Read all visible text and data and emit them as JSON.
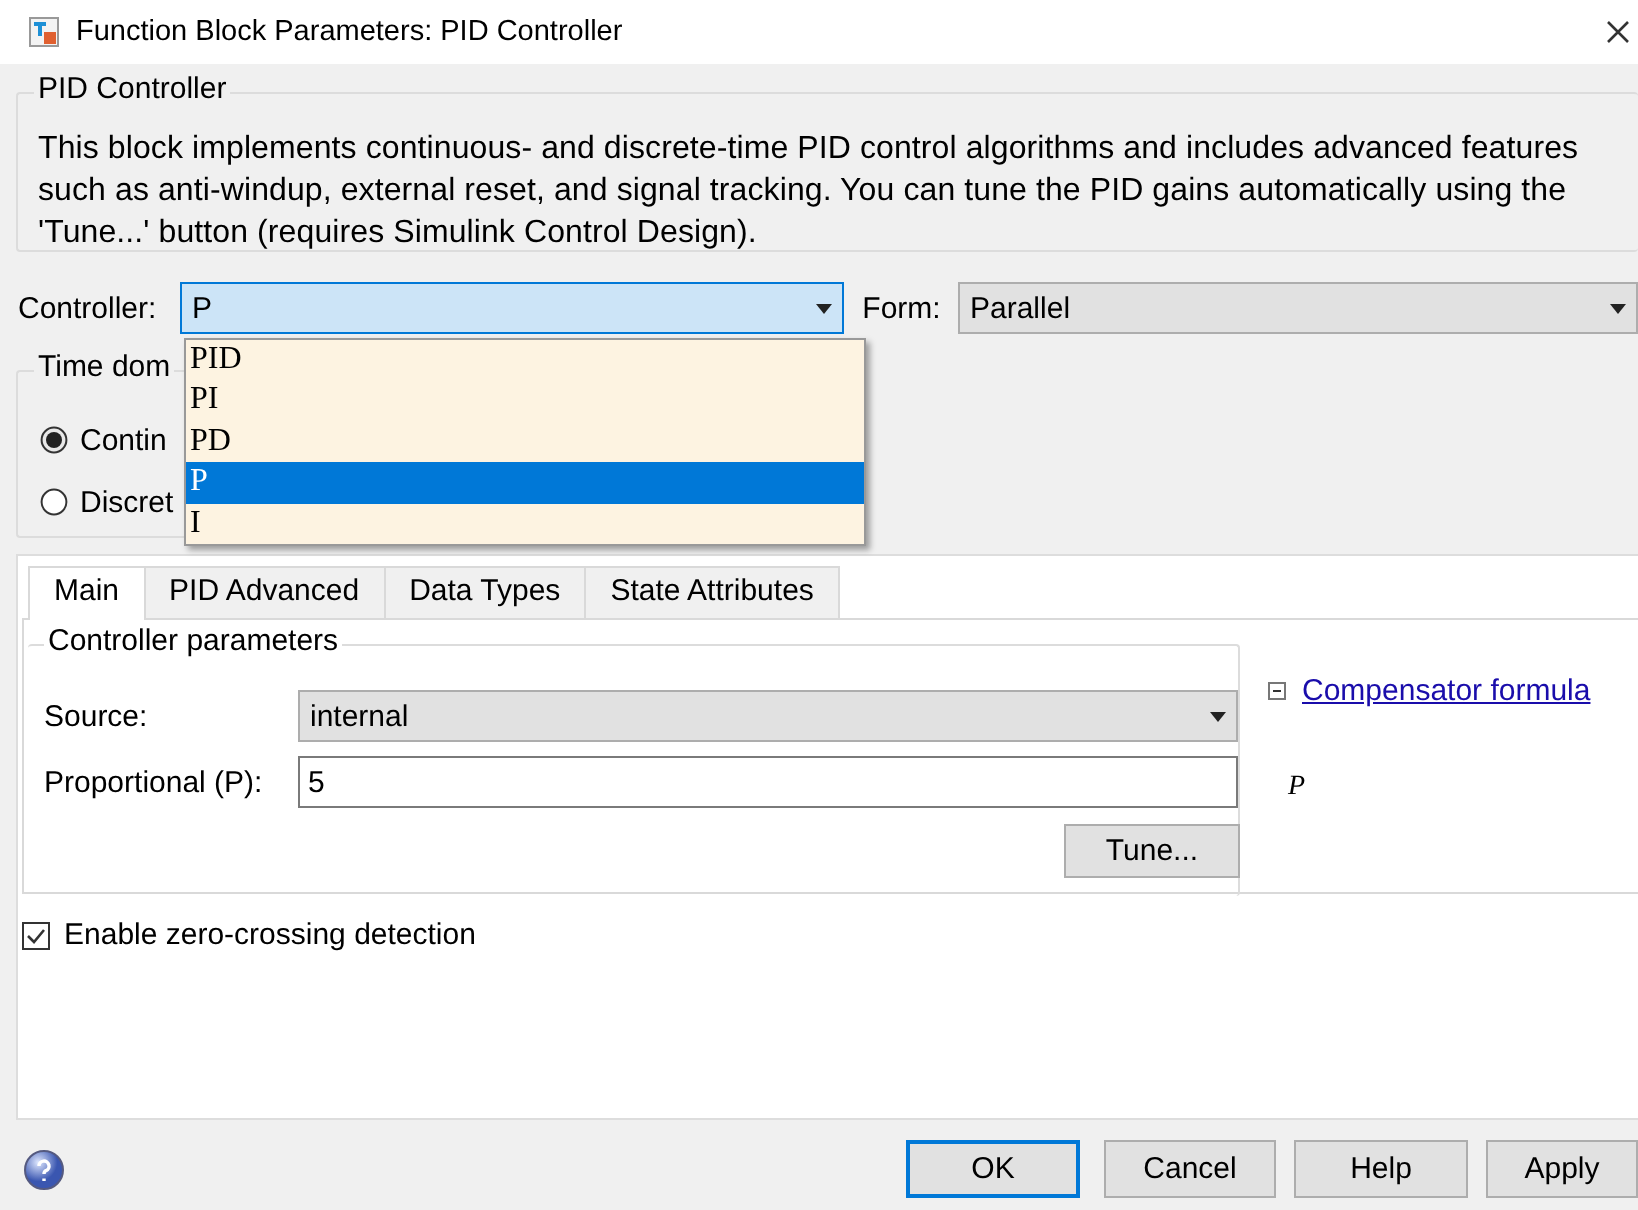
{
  "window": {
    "title": "Function Block Parameters: PID Controller"
  },
  "block_group": {
    "title": "PID Controller",
    "description": "This block implements continuous- and discrete-time PID control algorithms and includes advanced features such as anti-windup, external reset, and signal tracking. You can tune the PID gains automatically using the 'Tune...' button (requires Simulink Control Design)."
  },
  "controller": {
    "label": "Controller:",
    "value": "P",
    "expanded": true,
    "options": [
      {
        "label": "PID",
        "selected": false
      },
      {
        "label": "PI",
        "selected": false
      },
      {
        "label": "PD",
        "selected": false
      },
      {
        "label": "P",
        "selected": true
      },
      {
        "label": "I",
        "selected": false
      }
    ]
  },
  "form": {
    "label": "Form:",
    "value": "Parallel"
  },
  "time_domain": {
    "title": "Time dom",
    "options": [
      {
        "label": "Contin",
        "selected": true
      },
      {
        "label": "Discret",
        "selected": false
      }
    ]
  },
  "tabs": [
    {
      "label": "Main",
      "selected": true
    },
    {
      "label": "PID Advanced",
      "selected": false
    },
    {
      "label": "Data Types",
      "selected": false
    },
    {
      "label": "State Attributes",
      "selected": false
    }
  ],
  "controller_parameters": {
    "title": "Controller parameters",
    "source": {
      "label": "Source:",
      "value": "internal"
    },
    "proportional": {
      "label": "Proportional (P):",
      "value": "5"
    },
    "tune_button": "Tune...",
    "formula": {
      "link": "Compensator formula",
      "expanded": true,
      "expression": "P"
    }
  },
  "zero_crossing": {
    "label": "Enable zero-crossing detection",
    "checked": true
  },
  "buttons": [
    {
      "label": "OK",
      "default": true
    },
    {
      "label": "Cancel",
      "default": false
    },
    {
      "label": "Help",
      "default": false
    },
    {
      "label": "Apply",
      "default": false
    }
  ]
}
